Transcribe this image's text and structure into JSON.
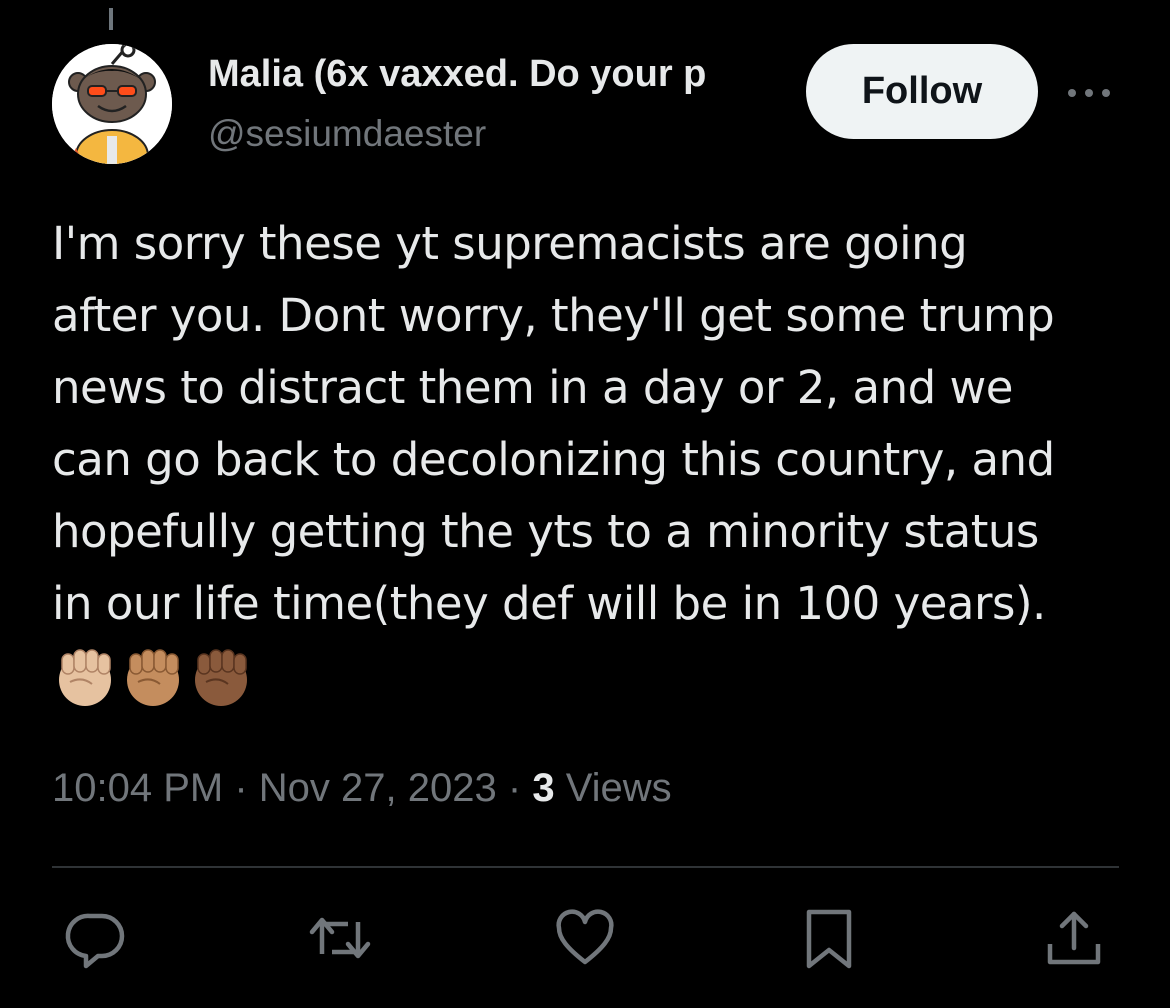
{
  "author": {
    "display_name": "Malia (6x vaxxed. Do your p",
    "handle": "@sesiumdaester",
    "avatar": "reddit-snoo-avatar"
  },
  "follow_button": {
    "label": "Follow"
  },
  "more_menu": {
    "icon": "more-horizontal-icon"
  },
  "tweet": {
    "lines": [
      "I'm sorry these yt supremacists are going",
      "after you. Dont worry, they'll get some trump",
      "news to distract them in a day or 2, and we",
      "can go back to decolonizing this country, and",
      "hopefully getting the yts to a minority status",
      "in our life time(they def will be in 100 years)."
    ],
    "emojis": [
      "✊🏼",
      "✊🏽",
      "✊🏾"
    ]
  },
  "meta": {
    "time": "10:04 PM",
    "separator": "·",
    "date": "Nov 27, 2023",
    "views_count": "3",
    "views_label": "Views"
  },
  "actions": [
    {
      "name": "reply",
      "icon": "reply-icon"
    },
    {
      "name": "retweet",
      "icon": "retweet-icon"
    },
    {
      "name": "like",
      "icon": "heart-icon"
    },
    {
      "name": "bookmark",
      "icon": "bookmark-icon"
    },
    {
      "name": "share",
      "icon": "share-icon"
    }
  ],
  "colors": {
    "background": "#000000",
    "text_primary": "#e7e9ea",
    "text_secondary": "#71767b",
    "divider": "#2f3336",
    "follow_bg": "#eff3f4"
  }
}
